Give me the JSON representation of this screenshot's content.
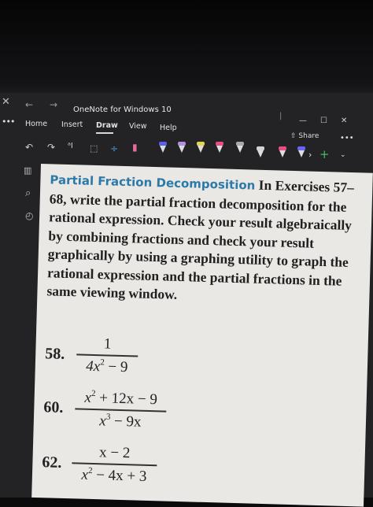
{
  "window": {
    "app_title": "OneNote for Windows 10",
    "controls": {
      "separator": "|",
      "minimize": "—",
      "maximize": "☐",
      "close": "✕"
    }
  },
  "nav": {
    "back": "←",
    "forward": "→",
    "menu_dots": "•••",
    "close_mark": "✕"
  },
  "tabs": [
    {
      "label": "Home"
    },
    {
      "label": "Insert"
    },
    {
      "label": "Draw",
      "active": true
    },
    {
      "label": "View"
    },
    {
      "label": "Help"
    }
  ],
  "toolbar": {
    "share_label": "Share",
    "more_label": "•••",
    "pen_colors": [
      "#5a60e8",
      "#b48ee0",
      "#e3d451",
      "#ea4c88",
      "#aaaaaa",
      "#d4d4d4",
      "#ea4c88",
      "#6c63ff"
    ]
  },
  "content": {
    "section_title": "Partial Fraction Decomposition",
    "intro_lead": "In Exercises",
    "intro_body": "57–68, write the partial fraction decomposition for the rational expression. Check your result algebraically by combining fractions and check your result graphically by using a graphing utility to graph the rational expression and the partial fractions in the same viewing window.",
    "problems": [
      {
        "number": "58.",
        "numerator": "1",
        "den_a": "4x",
        "den_exp": "2",
        "den_b": " − 9"
      },
      {
        "number": "60.",
        "num_a": "x",
        "num_exp": "2",
        "num_b": " + 12x − 9",
        "den_a": "x",
        "den_exp": "3",
        "den_b": " − 9x"
      },
      {
        "number": "62.",
        "numerator": "x − 2",
        "den_a": "x",
        "den_exp": "2",
        "den_b": " − 4x + 3"
      }
    ]
  },
  "colors": {
    "title_accent": "#2b7aa9",
    "plus_green": "#3fbf5a"
  }
}
